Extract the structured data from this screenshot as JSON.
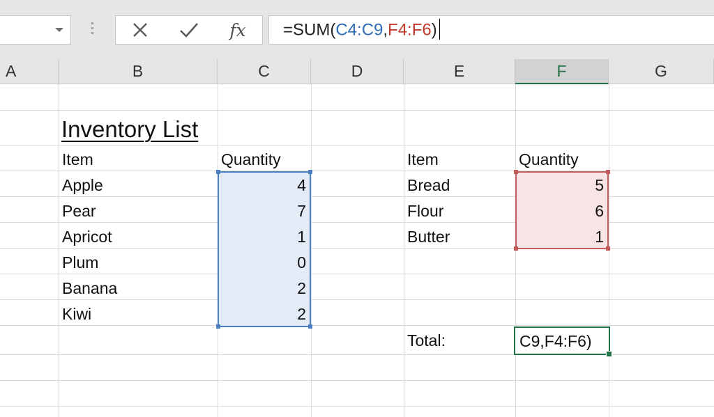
{
  "formula_bar": {
    "name_box_value": "",
    "cancel_icon": "x-icon",
    "enter_icon": "check-icon",
    "fx_label": "fx",
    "formula_prefix": "=SUM(",
    "ref1": "C4:C9",
    "comma": ",",
    "ref2": "F4:F6",
    "formula_suffix": ")"
  },
  "columns": [
    {
      "label": "A",
      "selected": false
    },
    {
      "label": "B",
      "selected": false
    },
    {
      "label": "C",
      "selected": false
    },
    {
      "label": "D",
      "selected": false
    },
    {
      "label": "E",
      "selected": false
    },
    {
      "label": "F",
      "selected": true
    },
    {
      "label": "G",
      "selected": false
    }
  ],
  "sheet": {
    "title": "Inventory List",
    "table1": {
      "header_item": "Item",
      "header_qty": "Quantity",
      "rows": [
        {
          "item": "Apple",
          "qty": "4"
        },
        {
          "item": "Pear",
          "qty": "7"
        },
        {
          "item": "Apricot",
          "qty": "1"
        },
        {
          "item": "Plum",
          "qty": "0"
        },
        {
          "item": "Banana",
          "qty": "2"
        },
        {
          "item": "Kiwi",
          "qty": "2"
        }
      ]
    },
    "table2": {
      "header_item": "Item",
      "header_qty": "Quantity",
      "rows": [
        {
          "item": "Bread",
          "qty": "5"
        },
        {
          "item": "Flour",
          "qty": "6"
        },
        {
          "item": "Butter",
          "qty": "1"
        }
      ]
    },
    "total_label": "Total:",
    "active_cell_text": "C9,F4:F6)"
  },
  "colors": {
    "ref_blue": "#2f6db6",
    "ref_red": "#c0392b",
    "accent_green": "#217346"
  }
}
